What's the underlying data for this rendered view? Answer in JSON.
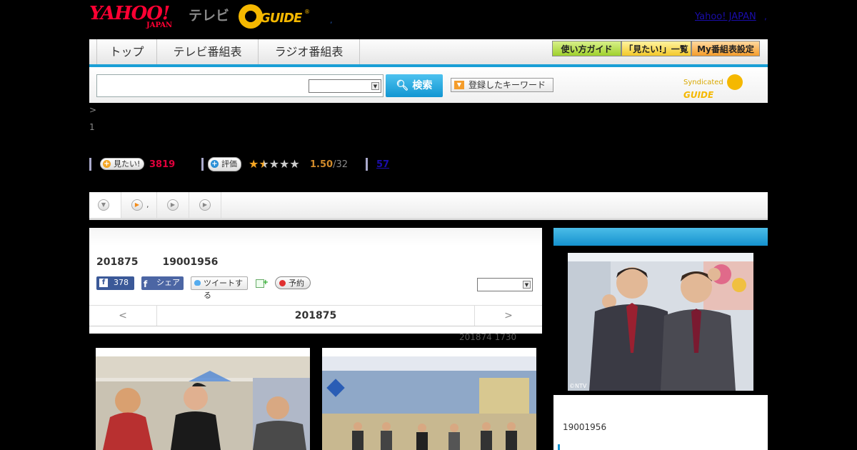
{
  "header": {
    "yahoo_logo_main": "YAHOO!",
    "yahoo_logo_sub": "JAPAN",
    "tv_label": "テレビ",
    "gguide_logo": "GUIDE",
    "gguide_reg": "®",
    "comma": ",",
    "yahoo_japan_link": "Yahoo! JAPAN",
    "link_sep": ","
  },
  "nav": {
    "tabs": [
      {
        "label": "トップ"
      },
      {
        "label": "テレビ番組表"
      },
      {
        "label": "ラジオ番組表"
      }
    ],
    "right_buttons": [
      {
        "label": "使い方ガイド",
        "color": "#9fd12c"
      },
      {
        "label": "「見たい!」一覧",
        "color": "#f3c92a"
      },
      {
        "label": "My番組表設定",
        "color": "#f49c2a"
      }
    ]
  },
  "search": {
    "input_value": "",
    "select_value": "",
    "button_label": "検索",
    "keyword_button_label": "登録したキーワード",
    "syndicated_label": "Syndicated",
    "syndicated_logo": "GUIDE"
  },
  "breadcrumb": ">",
  "page_number": "1",
  "stats": {
    "mitai_label": "見たい!",
    "mitai_count": "3819",
    "hyouka_label": "評価",
    "rating_stars": 1.5,
    "rating_value": "1.50",
    "rating_count": "/32",
    "review_count": "57"
  },
  "tabs_strip": {
    "tab2_suffix": ","
  },
  "program": {
    "date": "201875",
    "time": "19001956",
    "fb_count": "378",
    "fb_share_label": "シェア",
    "tweet_label": "ツイートする",
    "reserve_label": "予約",
    "select_value": "",
    "prev_label": "<",
    "current_date": "201875",
    "next_label": ">",
    "updated": "201874  1730"
  },
  "sidebar": {
    "image_credit": "©NTV",
    "time": "19001956"
  },
  "colors": {
    "accent_blue": "#1a9fd6",
    "count_red": "#e0003c",
    "star_orange": "#f5a623"
  }
}
